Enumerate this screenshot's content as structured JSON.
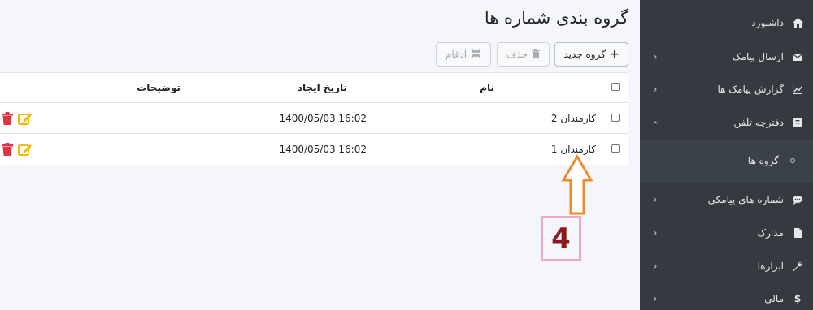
{
  "sidebar": {
    "items": [
      {
        "label": "داشبورد",
        "icon": "home-icon",
        "has_chevron": false
      },
      {
        "label": "ارسال پیامک",
        "icon": "envelope-icon",
        "has_chevron": true
      },
      {
        "label": "گزارش پیامک ها",
        "icon": "chart-icon",
        "has_chevron": true
      },
      {
        "label": "دفترچه تلفن",
        "icon": "address-book-icon",
        "has_chevron": true,
        "expanded": true
      },
      {
        "label": "شماره های پیامکی",
        "icon": "comment-icon",
        "has_chevron": true
      },
      {
        "label": "مدارک",
        "icon": "file-icon",
        "has_chevron": true
      },
      {
        "label": "ابزارها",
        "icon": "wrench-icon",
        "has_chevron": true
      },
      {
        "label": "مالی",
        "icon": "dollar-icon",
        "has_chevron": true
      }
    ],
    "sub_items": [
      {
        "label": "گروه ها"
      }
    ]
  },
  "page": {
    "title": "گروه بندی شماره ها"
  },
  "toolbar": {
    "new_label": "گروه جدید",
    "delete_label": "حذف",
    "merge_label": "ادغام"
  },
  "table": {
    "headers": {
      "name": "نام",
      "created": "تاریخ ایجاد",
      "description": "توضیحات"
    },
    "rows": [
      {
        "name": "کارمندان 2",
        "created": "1400/05/03 16:02",
        "description": ""
      },
      {
        "name": "کارمندان 1",
        "created": "1400/05/03 16:02",
        "description": ""
      }
    ]
  },
  "annotation": {
    "number": "4"
  },
  "colors": {
    "sidebar_bg": "#343a40",
    "edit_icon": "#f5b800",
    "delete_icon": "#dc3545",
    "arrow": "#f08a30",
    "annotation_border": "#f2a7c8",
    "annotation_text": "#8b1a1a"
  }
}
